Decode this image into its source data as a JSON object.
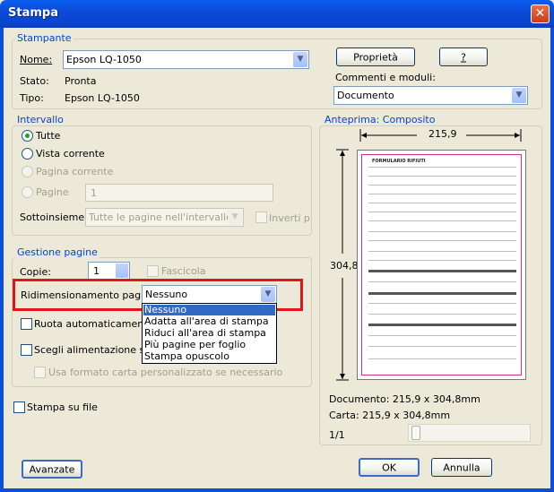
{
  "window": {
    "title": "Stampa",
    "close_glyph": "✕"
  },
  "printer": {
    "legend": "Stampante",
    "name_label": "Nome:",
    "name_value": "Epson LQ-1050",
    "status_label": "Stato:",
    "status_value": "Pronta",
    "type_label": "Tipo:",
    "type_value": "Epson LQ-1050",
    "properties_button": "Proprietà",
    "help_button": "?",
    "comments_label": "Commenti e moduli:",
    "comments_value": "Documento"
  },
  "range": {
    "legend": "Intervallo",
    "all": "Tutte",
    "current_view": "Vista corrente",
    "current_page": "Pagina corrente",
    "pages": "Pagine",
    "pages_value": "1",
    "subset_label": "Sottoinsieme:",
    "subset_value": "Tutte le pagine nell'intervallo",
    "reverse": "Inverti p"
  },
  "handling": {
    "legend": "Gestione pagine",
    "copies_label": "Copie:",
    "copies_value": "1",
    "collate": "Fascicola",
    "scaling_label": "Ridimensionamento pagina:",
    "scaling_value": "Nessuno",
    "scaling_options": [
      "Nessuno",
      "Adatta all'area di stampa",
      "Riduci all'area di stampa",
      "Più pagine per foglio",
      "Stampa opuscolo"
    ],
    "autorotate": "Ruota automaticamente e",
    "choose_source": "Scegli alimentazione seco",
    "custom_paper": "Usa formato carta personalizzato se necessario"
  },
  "print_to_file": "Stampa su file",
  "preview": {
    "legend": "Anteprima: Composito",
    "width": "215,9",
    "height": "304,8",
    "document_size": "Documento: 215,9 x 304,8mm",
    "paper_size": "Carta: 215,9 x 304,8mm",
    "page_indicator": "1/1",
    "form_title": "FORMULARIO RIFIUTI"
  },
  "buttons": {
    "advanced": "Avanzate",
    "ok": "OK",
    "cancel": "Annulla"
  },
  "colors": {
    "titlebar": "#0a4fd8",
    "legend_text": "#0046d5",
    "highlight": "#316ac5",
    "red_frame": "#e0161a",
    "form_border": "#cc3388"
  },
  "icons": {
    "dropdown": "chevron-down-icon",
    "close": "close-icon",
    "spin": "spin-arrows-icon"
  }
}
